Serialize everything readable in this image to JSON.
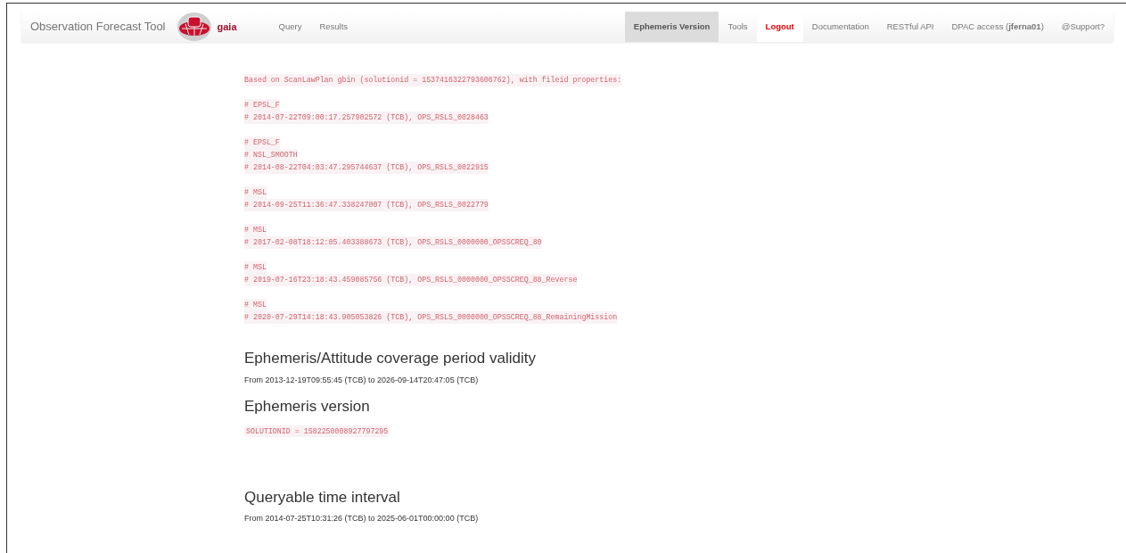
{
  "navbar": {
    "brand": "Observation Forecast Tool",
    "logo_text": "gaia",
    "left_items": [
      {
        "label": "Query",
        "selected": false
      },
      {
        "label": "Results",
        "selected": false
      }
    ],
    "right_items": [
      {
        "label": "Ephemeris Version",
        "selected": true,
        "kind": "link"
      },
      {
        "label": "Tools",
        "selected": false,
        "kind": "link"
      },
      {
        "label": "Logout",
        "selected": false,
        "kind": "logout"
      },
      {
        "label": "Documentation",
        "selected": false,
        "kind": "link"
      },
      {
        "label": "RESTful API",
        "selected": false,
        "kind": "link"
      },
      {
        "label": "DPAC access (**jferna01**)",
        "selected": false,
        "kind": "link"
      },
      {
        "label": "@Support?",
        "selected": false,
        "kind": "link"
      }
    ]
  },
  "scanlaw_code": [
    [
      "Based on ScanLawPlan gbin (solutionid = 1537416322793606762), with fileid properties:"
    ],
    [
      "# EPSL_F",
      "# 2014-07-22T09:00:17.257902572 (TCB), OPS_RSLS_0028463"
    ],
    [
      "# EPSL_F",
      "# NSL_SMOOTH",
      "# 2014-08-22T04:03:47.295744637 (TCB), OPS_RSLS_0022915"
    ],
    [
      "# MSL",
      "# 2014-09-25T11:36:47.338247007 (TCB), OPS_RSLS_0022779"
    ],
    [
      "# MSL",
      "# 2017-02-08T18:12:05.403388673 (TCB), OPS_RSLS_0000000_OPSSCREQ_80"
    ],
    [
      "# MSL",
      "# 2019-07-16T23:18:43.459085756 (TCB), OPS_RSLS_0000000_OPSSCREQ_88_Reverse"
    ],
    [
      "# MSL",
      "# 2020-07-29T14:18:43.905053826 (TCB), OPS_RSLS_0000000_OPSSCREQ_88_RemainingMission"
    ]
  ],
  "coverage": {
    "heading": "Ephemeris/Attitude coverage period validity",
    "text": "From 2013-12-19T09:55:45 (TCB) to 2026-09-14T20:47:05 (TCB)"
  },
  "version": {
    "heading": "Ephemeris version",
    "code": "SOLUTIONID = 1582250008927797295"
  },
  "queryable": {
    "heading": "Queryable time interval",
    "text": "From 2014-07-25T10:31:26 (TCB) to 2025-06-01T00:00:00 (TCB)"
  }
}
